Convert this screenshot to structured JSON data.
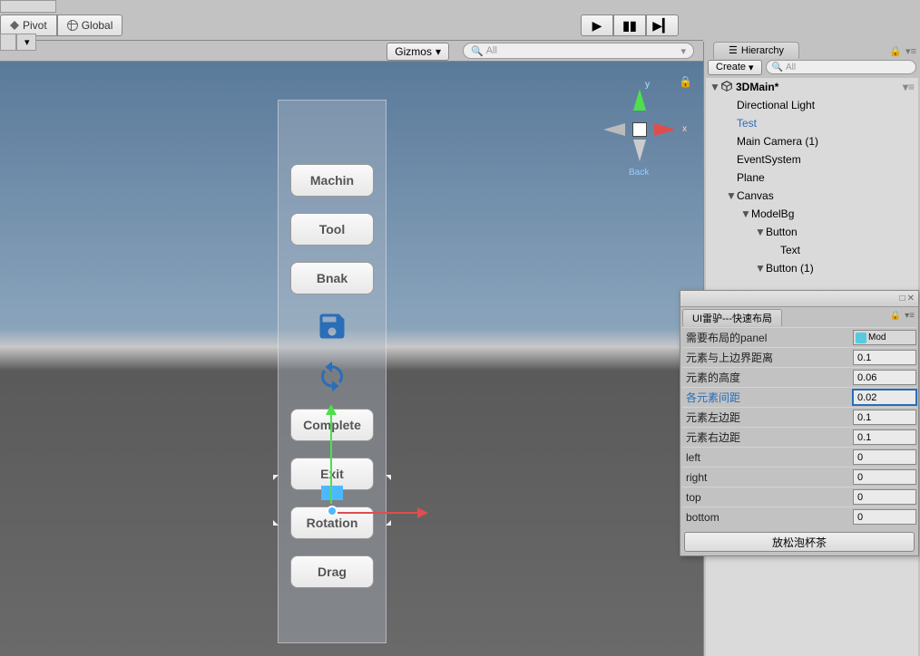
{
  "toolbar": {
    "pivot": "Pivot",
    "global": "Global"
  },
  "scene": {
    "gizmos": "Gizmos",
    "search_placeholder": "All",
    "axis": {
      "y": "y",
      "x": "x",
      "back": "Back"
    }
  },
  "ui_panel": {
    "buttons": [
      "Machin",
      "Tool",
      "Bnak",
      "Complete",
      "Exit",
      "Rotation",
      "Drag"
    ]
  },
  "hierarchy": {
    "title": "Hierarchy",
    "create": "Create",
    "search_placeholder": "All",
    "scene": "3DMain*",
    "items": [
      "Directional Light",
      "Test",
      "Main Camera (1)",
      "EventSystem",
      "Plane",
      "Canvas",
      "ModelBg",
      "Button",
      "Text",
      "Button (1)"
    ]
  },
  "inspector": {
    "window_title": "UI雷驴---快速布局",
    "object_label": "Mod",
    "rows": [
      {
        "label": "需要布局的panel",
        "value": "_obj_"
      },
      {
        "label": "元素与上边界距离",
        "value": "0.1"
      },
      {
        "label": "元素的高度",
        "value": "0.06"
      },
      {
        "label": "各元素间距",
        "value": "0.02",
        "active": true
      },
      {
        "label": "元素左边距",
        "value": "0.1"
      },
      {
        "label": "元素右边距",
        "value": "0.1"
      },
      {
        "label": "left",
        "value": "0"
      },
      {
        "label": "right",
        "value": "0"
      },
      {
        "label": "top",
        "value": "0"
      },
      {
        "label": "bottom",
        "value": "0"
      }
    ],
    "button": "放松泡杯茶"
  }
}
